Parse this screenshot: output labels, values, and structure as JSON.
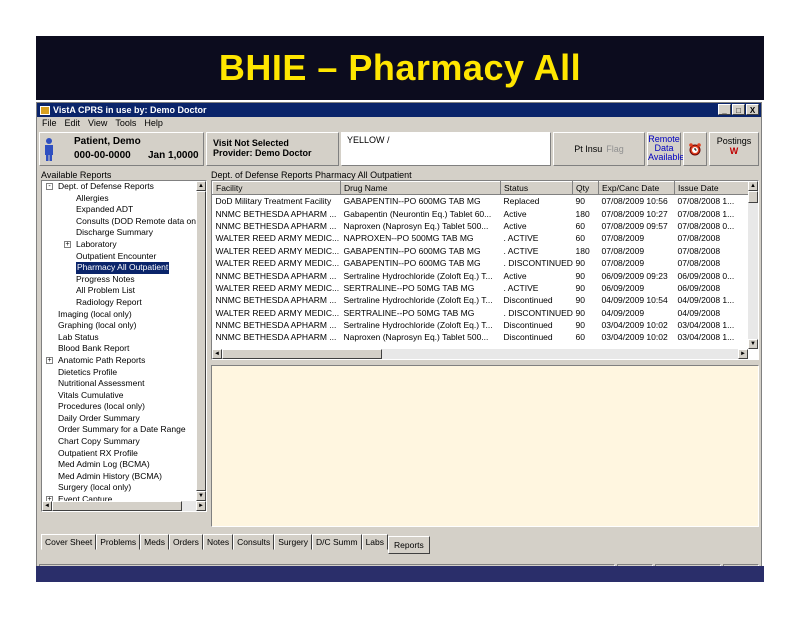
{
  "slide": {
    "title": "BHIE – Pharmacy All"
  },
  "window": {
    "title": "VistA CPRS in use by:  Demo Doctor",
    "controls": [
      "_",
      "□",
      "X"
    ]
  },
  "menu": [
    "File",
    "Edit",
    "View",
    "Tools",
    "Help"
  ],
  "patient": {
    "name": "Patient, Demo",
    "ssn": "000-00-0000",
    "dob": "Jan 1,0000"
  },
  "visit": {
    "line1": "Visit Not Selected",
    "line2": "Provider: Demo Doctor"
  },
  "postings_line": "YELLOW /",
  "flags": {
    "pt_insur": "Pt Insu",
    "flag": "Flag"
  },
  "remote": {
    "line1": "Remote",
    "line2": "Data",
    "line3": "Available"
  },
  "postings": {
    "label": "Postings",
    "mark": "W"
  },
  "left_panel": {
    "label": "Available Reports",
    "items": [
      {
        "label": "Dept. of Defense Reports",
        "indent": 0,
        "expander": "-",
        "selected": false
      },
      {
        "label": "Allergies",
        "indent": 1,
        "expander": "",
        "selected": false
      },
      {
        "label": "Expanded ADT",
        "indent": 1,
        "expander": "",
        "selected": false
      },
      {
        "label": "Consults (DOD Remote data only",
        "indent": 1,
        "expander": "",
        "selected": false
      },
      {
        "label": "Discharge Summary",
        "indent": 1,
        "expander": "",
        "selected": false
      },
      {
        "label": "Laboratory",
        "indent": 1,
        "expander": "+",
        "selected": false
      },
      {
        "label": "Outpatient Encounter",
        "indent": 1,
        "expander": "",
        "selected": false
      },
      {
        "label": "Pharmacy All Outpatient",
        "indent": 1,
        "expander": "",
        "selected": true
      },
      {
        "label": "Progress Notes",
        "indent": 1,
        "expander": "",
        "selected": false
      },
      {
        "label": "All Problem List",
        "indent": 1,
        "expander": "",
        "selected": false
      },
      {
        "label": "Radiology Report",
        "indent": 1,
        "expander": "",
        "selected": false
      },
      {
        "label": "Imaging (local only)",
        "indent": 0,
        "expander": "",
        "selected": false
      },
      {
        "label": "Graphing (local only)",
        "indent": 0,
        "expander": "",
        "selected": false
      },
      {
        "label": "Lab Status",
        "indent": 0,
        "expander": "",
        "selected": false
      },
      {
        "label": "Blood Bank Report",
        "indent": 0,
        "expander": "",
        "selected": false
      },
      {
        "label": "Anatomic Path Reports",
        "indent": 0,
        "expander": "+",
        "selected": false
      },
      {
        "label": "Dietetics Profile",
        "indent": 0,
        "expander": "",
        "selected": false
      },
      {
        "label": "Nutritional Assessment",
        "indent": 0,
        "expander": "",
        "selected": false
      },
      {
        "label": "Vitals Cumulative",
        "indent": 0,
        "expander": "",
        "selected": false
      },
      {
        "label": "Procedures (local only)",
        "indent": 0,
        "expander": "",
        "selected": false
      },
      {
        "label": "Daily Order Summary",
        "indent": 0,
        "expander": "",
        "selected": false
      },
      {
        "label": "Order Summary for a Date Range",
        "indent": 0,
        "expander": "",
        "selected": false
      },
      {
        "label": "Chart Copy Summary",
        "indent": 0,
        "expander": "",
        "selected": false
      },
      {
        "label": "Outpatient RX Profile",
        "indent": 0,
        "expander": "",
        "selected": false
      },
      {
        "label": "Med Admin Log (BCMA)",
        "indent": 0,
        "expander": "",
        "selected": false
      },
      {
        "label": "Med Admin History (BCMA)",
        "indent": 0,
        "expander": "",
        "selected": false
      },
      {
        "label": "Surgery (local only)",
        "indent": 0,
        "expander": "",
        "selected": false
      },
      {
        "label": "Event Capture",
        "indent": 0,
        "expander": "+",
        "selected": false
      }
    ]
  },
  "report": {
    "label": "Dept. of Defense Reports Pharmacy All Outpatient",
    "columns": [
      "Facility",
      "Drug Name",
      "Status",
      "Qty",
      "Exp/Canc Date",
      "Issue Date"
    ],
    "rows": [
      [
        "DoD Military Treatment Facility",
        "GABAPENTIN--PO 600MG TAB  MG",
        "Replaced",
        "90",
        "07/08/2009 10:56",
        "07/08/2008 1..."
      ],
      [
        "NNMC BETHESDA APHARM ...",
        "Gabapentin (Neurontin Eq.) Tablet 60...",
        "Active",
        "180",
        "07/08/2009 10:27",
        "07/08/2008 1..."
      ],
      [
        "NNMC BETHESDA APHARM ...",
        "Naproxen (Naprosyn Eq.) Tablet 500...",
        "Active",
        "60",
        "07/08/2009 09:57",
        "07/08/2008 0..."
      ],
      [
        "WALTER REED ARMY MEDIC...",
        "NAPROXEN--PO 500MG TAB  MG",
        ". ACTIVE",
        "60",
        "07/08/2009",
        "07/08/2008"
      ],
      [
        "WALTER REED ARMY MEDIC...",
        "GABAPENTIN--PO 600MG TAB  MG",
        ". ACTIVE",
        "180",
        "07/08/2009",
        "07/08/2008"
      ],
      [
        "WALTER REED ARMY MEDIC...",
        "GABAPENTIN--PO 600MG TAB  MG",
        ". DISCONTINUED",
        "90",
        "07/08/2009",
        "07/08/2008"
      ],
      [
        "NNMC BETHESDA APHARM ...",
        "Sertraline Hydrochloride (Zoloft Eq.) T...",
        "Active",
        "90",
        "06/09/2009 09:23",
        "06/09/2008 0..."
      ],
      [
        "WALTER REED ARMY MEDIC...",
        "SERTRALINE--PO 50MG TAB  MG",
        ". ACTIVE",
        "90",
        "06/09/2009",
        "06/09/2008"
      ],
      [
        "NNMC BETHESDA APHARM ...",
        "Sertraline Hydrochloride (Zoloft Eq.) T...",
        "Discontinued",
        "90",
        "04/09/2009 10:54",
        "04/09/2008 1..."
      ],
      [
        "WALTER REED ARMY MEDIC...",
        "SERTRALINE--PO 50MG TAB  MG",
        ". DISCONTINUED",
        "90",
        "04/09/2009",
        "04/09/2008"
      ],
      [
        "NNMC BETHESDA APHARM ...",
        "Sertraline Hydrochloride (Zoloft Eq.) T...",
        "Discontinued",
        "90",
        "03/04/2009 10:02",
        "03/04/2008 1..."
      ],
      [
        "NNMC BETHESDA APHARM ...",
        "Naproxen (Naprosyn Eq.) Tablet 500...",
        "Discontinued",
        "60",
        "03/04/2009 10:02",
        "03/04/2008 1..."
      ]
    ]
  },
  "tabs": [
    {
      "label": "Cover Sheet",
      "active": false
    },
    {
      "label": "Problems",
      "active": false
    },
    {
      "label": "Meds",
      "active": false
    },
    {
      "label": "Orders",
      "active": false
    },
    {
      "label": "Notes",
      "active": false
    },
    {
      "label": "Consults",
      "active": false
    },
    {
      "label": "Surgery",
      "active": false
    },
    {
      "label": "D/C Summ",
      "active": false
    },
    {
      "label": "Labs",
      "active": false
    },
    {
      "label": "Reports",
      "active": true
    }
  ],
  "colors": {
    "title_text": "#ffe600",
    "title_bg": "#0c0c1e",
    "selection": "#0a246a",
    "remote_link": "#0000c0",
    "postings_mark": "#c00000"
  }
}
